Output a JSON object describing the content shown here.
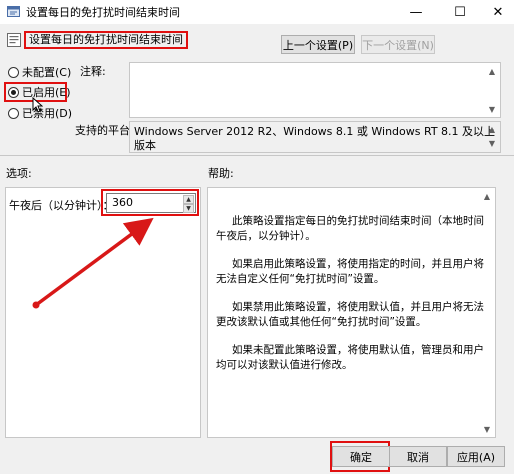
{
  "window": {
    "title": "设置每日的免打扰时间结束时间",
    "controls": {
      "minimize": "—",
      "maximize": "☐",
      "close": "✕"
    }
  },
  "header": {
    "policy_title": "设置每日的免打扰时间结束时间",
    "prev_button": "上一个设置(P)",
    "next_button": "下一个设置(N)"
  },
  "state": {
    "options": [
      {
        "label": "未配置(C)",
        "checked": false
      },
      {
        "label": "已启用(E)",
        "checked": true
      },
      {
        "label": "已禁用(D)",
        "checked": false
      }
    ]
  },
  "comment": {
    "label": "注释:"
  },
  "supported": {
    "label": "支持的平台:",
    "value": "Windows Server 2012 R2、Windows 8.1 或 Windows RT 8.1 及以上版本"
  },
  "options_panel": {
    "label": "选项:",
    "field_label": "午夜后（以分钟计）：",
    "field_value": "360"
  },
  "help_panel": {
    "label": "帮助:",
    "paragraphs": [
      "此策略设置指定每日的免打扰时间结束时间（本地时间午夜后，以分钟计）。",
      "如果启用此策略设置，将使用指定的时间，并且用户将无法自定义任何“免打扰时间”设置。",
      "如果禁用此策略设置，将使用默认值，并且用户将无法更改该默认值或其他任何“免打扰时间”设置。",
      "如果未配置此策略设置，将使用默认值，管理员和用户均可以对该默认值进行修改。"
    ]
  },
  "footer": {
    "ok": "确定",
    "cancel": "取消",
    "apply": "应用(A)"
  },
  "colors": {
    "highlight_red": "#e01010",
    "panel_bg": "#f0f0f0"
  }
}
